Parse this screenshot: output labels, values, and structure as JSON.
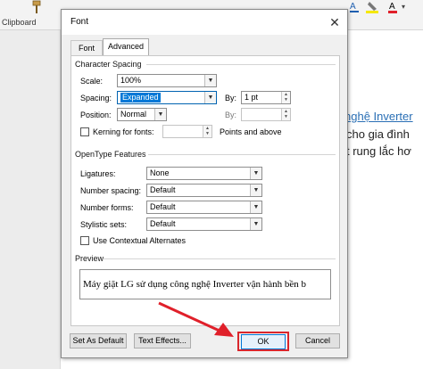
{
  "background": {
    "clipboard_label": "Clipboard",
    "doc_link_text": "nghệ Inverter",
    "doc_line_2": "cho gia đình",
    "doc_line_3": "t rung lắc hơ"
  },
  "dialog": {
    "title": "Font",
    "close_glyph": "✕",
    "tabs": [
      {
        "label": "Font",
        "active": false
      },
      {
        "label": "Advanced",
        "active": true
      }
    ],
    "character_spacing": {
      "heading": "Character Spacing",
      "scale_label": "Scale:",
      "scale_value": "100%",
      "spacing_label": "Spacing:",
      "spacing_value": "Expanded",
      "spacing_by_label": "By:",
      "spacing_by_value": "1 pt",
      "position_label": "Position:",
      "position_value": "Normal",
      "position_by_label": "By:",
      "position_by_value": "",
      "kerning_label": "Kerning for fonts:",
      "kerning_checked": false,
      "kerning_value": "",
      "kerning_suffix": "Points and above"
    },
    "opentype": {
      "heading": "OpenType Features",
      "ligatures_label": "Ligatures:",
      "ligatures_value": "None",
      "number_spacing_label": "Number spacing:",
      "number_spacing_value": "Default",
      "number_forms_label": "Number forms:",
      "number_forms_value": "Default",
      "stylistic_sets_label": "Stylistic sets:",
      "stylistic_sets_value": "Default",
      "contextual_label": "Use Contextual Alternates",
      "contextual_checked": false
    },
    "preview": {
      "heading": "Preview",
      "text": "Máy giặt LG sử dụng công nghệ Inverter vận hành bền b"
    },
    "buttons": {
      "set_default": "Set As Default",
      "text_effects": "Text Effects...",
      "ok": "OK",
      "cancel": "Cancel"
    }
  },
  "colors": {
    "accent": "#0078d7",
    "highlight": "#d9262c",
    "link": "#2a6fb5"
  }
}
